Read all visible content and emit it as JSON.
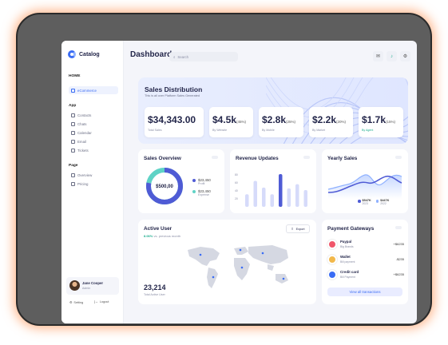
{
  "app": {
    "brand": "Catalog"
  },
  "sidebar": {
    "home_heading": "HOME",
    "home_items": [
      {
        "label": "eCommerce"
      }
    ],
    "app_heading": "App",
    "app_items": [
      {
        "label": "Contacts"
      },
      {
        "label": "Chats"
      },
      {
        "label": "Calendar"
      },
      {
        "label": "Email"
      },
      {
        "label": "Tickets"
      }
    ],
    "page_heading": "Page",
    "page_items": [
      {
        "label": "Overview"
      },
      {
        "label": "Pricing"
      }
    ],
    "user": {
      "name": "Jane Cooper",
      "role": "Admin"
    },
    "setting_label": "Setting",
    "logout_label": "Logout"
  },
  "header": {
    "title": "Dashboard",
    "search_placeholder": "Search"
  },
  "sales_distribution": {
    "title": "Sales Distribution",
    "subtitle": "This is all over Platform Sales Generated",
    "stats": [
      {
        "value": "$34,343.00",
        "pct": "",
        "label": "Total Sales"
      },
      {
        "value": "$4.5k",
        "pct": "(45%)",
        "label": "By Website"
      },
      {
        "value": "$2.8k",
        "pct": "(25%)",
        "label": "By Mobile"
      },
      {
        "value": "$2.2k",
        "pct": "(20%)",
        "label": "By Market"
      },
      {
        "value": "$1.7k",
        "pct": "(15%)",
        "label": "By Agent"
      }
    ]
  },
  "sales_overview": {
    "title": "Sales Overview",
    "center_value": "$500,00",
    "legend": [
      {
        "value": "$23,450",
        "label": "Profit",
        "color": "#4f5bd5"
      },
      {
        "value": "$23,450",
        "label": "Expense",
        "color": "#5fd3c6"
      }
    ],
    "profit_share": 0.78
  },
  "revenue_updates": {
    "title": "Revenue Updates",
    "y_ticks": [
      "80",
      "60",
      "40",
      "20"
    ],
    "bars": [
      {
        "value": 30,
        "highlight": false
      },
      {
        "value": 62,
        "highlight": false
      },
      {
        "value": 46,
        "highlight": false
      },
      {
        "value": 30,
        "highlight": false
      },
      {
        "value": 78,
        "highlight": true
      },
      {
        "value": 44,
        "highlight": false
      },
      {
        "value": 54,
        "highlight": false
      },
      {
        "value": 40,
        "highlight": false
      }
    ]
  },
  "yearly_sales": {
    "title": "Yearly Sales",
    "legend": [
      {
        "value": "$547K",
        "year": "2023",
        "color": "#4f5bd5"
      },
      {
        "value": "$447K",
        "year": "2022",
        "color": "#8fb1ff"
      }
    ]
  },
  "active_user": {
    "title": "Active User",
    "export_label": "Export",
    "change_pct": "8.06%",
    "change_text": "vs. previous month",
    "total_value": "23,214",
    "total_label": "Total Active User"
  },
  "payment_gateways": {
    "title": "Payment Gateways",
    "items": [
      {
        "name": "Paypal",
        "desc": "Big Brands",
        "amount": "+$6235",
        "icon": "paypal-icon",
        "color": "#f0566a"
      },
      {
        "name": "Wallet",
        "desc": "Bill payment",
        "amount": "-$235",
        "icon": "wallet-icon",
        "color": "#f2b84b"
      },
      {
        "name": "Credit card",
        "desc": "Bill Payment",
        "amount": "+$6235",
        "icon": "credit-card-icon",
        "color": "#3a6cf4"
      }
    ],
    "view_all_label": "View all transactions"
  },
  "colors": {
    "accent": "#3a6cf4",
    "teal": "#5fd3c6",
    "positive": "#1fae8f"
  }
}
